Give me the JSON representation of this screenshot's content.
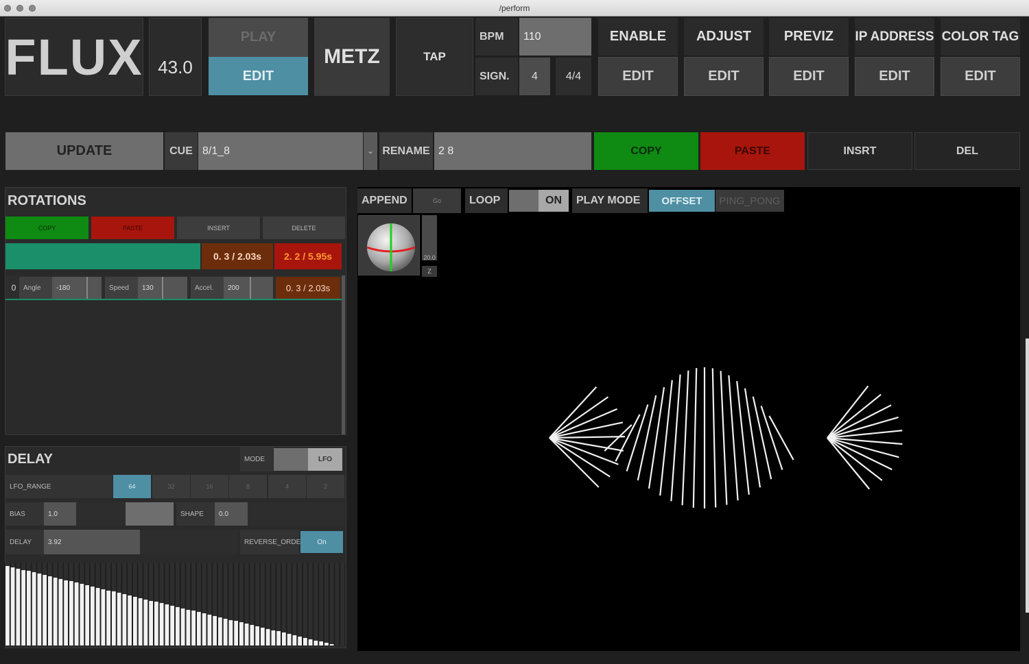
{
  "window": {
    "title": "/perform"
  },
  "header": {
    "logo": "FLUX",
    "version": "43.0",
    "play_label": "PLAY",
    "edit_label": "EDIT",
    "metz_label": "METZ",
    "tap_label": "TAP",
    "bpm_label": "BPM",
    "bpm_value": "110",
    "sign_label": "SIGN.",
    "sign_value": "4",
    "sign_fraction": "4/4",
    "columns": [
      {
        "label": "ENABLE",
        "edit": "EDIT"
      },
      {
        "label": "ADJUST",
        "edit": "EDIT"
      },
      {
        "label": "PREVIZ",
        "edit": "EDIT"
      },
      {
        "label": "IP ADDRESS",
        "edit": "EDIT"
      },
      {
        "label": "COLOR TAG",
        "edit": "EDIT"
      }
    ]
  },
  "cuebar": {
    "update_label": "UPDATE",
    "cue_label": "CUE",
    "cue_value": "8/1_8",
    "rename_label": "RENAME",
    "rename_value": "2 8",
    "copy_label": "COPY",
    "paste_label": "PASTE",
    "insert_label": "INSRT",
    "delete_label": "DEL"
  },
  "rotations": {
    "title": "ROTATIONS",
    "copy": "COPY",
    "paste": "PASTE",
    "insert": "INSERT",
    "delete": "DELETE",
    "time_current": "0. 3  /  2.03s",
    "time_total": "2. 2  /  5.95s",
    "row": {
      "index": "0",
      "angle_label": "Angle",
      "angle_value": "-180",
      "speed_label": "Speed",
      "speed_value": "130",
      "accel_label": "Accel.",
      "accel_value": "200",
      "time": "0. 3  /  2.03s"
    }
  },
  "delay": {
    "title": "DELAY",
    "mode_label": "MODE",
    "mode_value": "LFO",
    "lfo_range_label": "LFO_RANGE",
    "lfo_options": [
      "64",
      "32",
      "16",
      "8",
      "4",
      "2"
    ],
    "lfo_selected": "64",
    "bias_label": "BIAS",
    "bias_value": "1.0",
    "shape_label": "SHAPE",
    "shape_value": "0.0",
    "delay_label": "DELAY",
    "delay_value": "3.92",
    "reverse_label": "REVERSE_ORDER",
    "reverse_value": "On"
  },
  "viewport": {
    "append_label": "APPEND",
    "go_label": "Go",
    "loop_label": "LOOP",
    "loop_value": "ON",
    "playmode_label": "PLAY MODE",
    "offset_label": "OFFSET",
    "pingpong_label": "PING_PONG",
    "z_value": "20.0",
    "z_label": "Z"
  },
  "colors": {
    "accent_blue": "#4f8fa3",
    "copy_green": "#0f8a12",
    "paste_red": "#a8150c",
    "teal": "#1a8f6a",
    "timer_bg": "#6b2d0c",
    "timer_orange": "#ff7a1a"
  }
}
